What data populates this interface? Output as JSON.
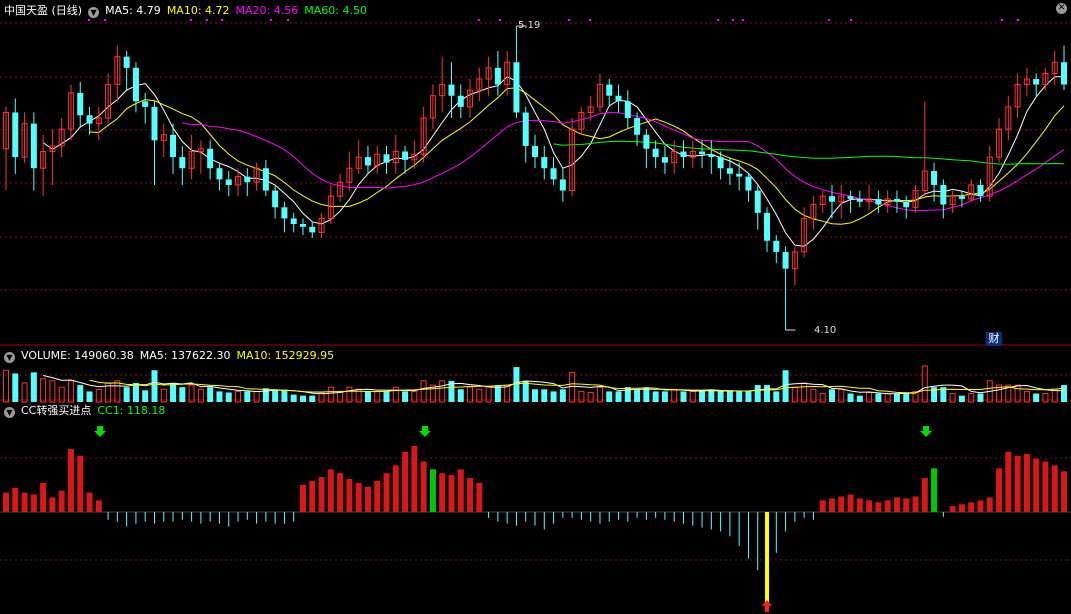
{
  "main_panel": {
    "stock_name": "中国天盈 (日线)",
    "indicators": [
      {
        "label": "MA5: 4.79",
        "color": "#ffffff"
      },
      {
        "label": "MA10: 4.72",
        "color": "#ffff00"
      },
      {
        "label": "MA20: 4.56",
        "color": "#ff00ff"
      },
      {
        "label": "MA60: 4.50",
        "color": "#00ff00"
      }
    ],
    "high_label": "5.19",
    "low_label": "4.10",
    "finance_badge": "财"
  },
  "volume_panel": {
    "indicators": [
      {
        "label": "VOLUME: 149060.38",
        "color": "#ffffff"
      },
      {
        "label": "MA5: 137622.30",
        "color": "#ffffff"
      },
      {
        "label": "MA10: 152929.95",
        "color": "#ffff00"
      }
    ]
  },
  "cc_panel": {
    "indicators": [
      {
        "label": "CC转强买进点",
        "color": "#ffffff"
      },
      {
        "label": "CC1: 118.18",
        "color": "#00ff00"
      }
    ]
  },
  "colors": {
    "up": "#ff3232",
    "down": "#54ffff",
    "grid": "#7a1a1a",
    "ma5": "#ffffff",
    "ma10": "#ffff00",
    "ma20": "#ff00ff",
    "ma60": "#00ff00",
    "cc_up": "#d81818",
    "cc_down": "#54ffff",
    "cc_signal": "#00c800",
    "cc_extreme": "#ffff00"
  },
  "chart_data": {
    "type": "candlestick",
    "price_range": [
      4.1,
      5.19
    ],
    "candles": [
      [
        4.75,
        4.88,
        4.6,
        4.9
      ],
      [
        4.88,
        4.72,
        4.66,
        4.93
      ],
      [
        4.72,
        4.84,
        4.7,
        4.88
      ],
      [
        4.84,
        4.68,
        4.6,
        4.88
      ],
      [
        4.68,
        4.74,
        4.58,
        4.8
      ],
      [
        4.74,
        4.76,
        4.62,
        4.82
      ],
      [
        4.76,
        4.82,
        4.72,
        4.86
      ],
      [
        4.82,
        4.95,
        4.78,
        4.98
      ],
      [
        4.95,
        4.87,
        4.83,
        4.99
      ],
      [
        4.87,
        4.84,
        4.8,
        4.9
      ],
      [
        4.84,
        4.86,
        4.78,
        4.9
      ],
      [
        4.86,
        4.98,
        4.84,
        5.02
      ],
      [
        4.98,
        5.08,
        4.92,
        5.12
      ],
      [
        5.08,
        5.04,
        4.96,
        5.1
      ],
      [
        5.04,
        4.92,
        4.88,
        5.06
      ],
      [
        4.92,
        4.9,
        4.84,
        4.95
      ],
      [
        4.9,
        4.78,
        4.62,
        4.92
      ],
      [
        4.78,
        4.8,
        4.72,
        4.84
      ],
      [
        4.8,
        4.72,
        4.66,
        4.84
      ],
      [
        4.72,
        4.68,
        4.62,
        4.76
      ],
      [
        4.68,
        4.74,
        4.64,
        4.8
      ],
      [
        4.74,
        4.75,
        4.66,
        4.78
      ],
      [
        4.75,
        4.68,
        4.64,
        4.78
      ],
      [
        4.68,
        4.64,
        4.6,
        4.7
      ],
      [
        4.64,
        4.62,
        4.58,
        4.67
      ],
      [
        4.62,
        4.65,
        4.58,
        4.68
      ],
      [
        4.65,
        4.63,
        4.58,
        4.68
      ],
      [
        4.63,
        4.68,
        4.6,
        4.7
      ],
      [
        4.68,
        4.6,
        4.58,
        4.71
      ],
      [
        4.6,
        4.54,
        4.5,
        4.62
      ],
      [
        4.54,
        4.5,
        4.45,
        4.56
      ],
      [
        4.5,
        4.48,
        4.45,
        4.52
      ],
      [
        4.48,
        4.47,
        4.44,
        4.5
      ],
      [
        4.47,
        4.45,
        4.43,
        4.49
      ],
      [
        4.45,
        4.5,
        4.43,
        4.52
      ],
      [
        4.5,
        4.58,
        4.48,
        4.62
      ],
      [
        4.58,
        4.63,
        4.56,
        4.66
      ],
      [
        4.63,
        4.68,
        4.6,
        4.74
      ],
      [
        4.68,
        4.72,
        4.66,
        4.78
      ],
      [
        4.72,
        4.69,
        4.66,
        4.76
      ],
      [
        4.69,
        4.73,
        4.66,
        4.76
      ],
      [
        4.73,
        4.7,
        4.66,
        4.76
      ],
      [
        4.7,
        4.74,
        4.66,
        4.8
      ],
      [
        4.74,
        4.71,
        4.66,
        4.76
      ],
      [
        4.71,
        4.73,
        4.68,
        4.78
      ],
      [
        4.73,
        4.86,
        4.7,
        4.9
      ],
      [
        4.86,
        4.94,
        4.82,
        4.98
      ],
      [
        4.94,
        4.98,
        4.88,
        5.08
      ],
      [
        4.98,
        4.94,
        4.86,
        5.06
      ],
      [
        4.94,
        4.9,
        4.86,
        4.98
      ],
      [
        4.9,
        4.96,
        4.86,
        5.0
      ],
      [
        4.96,
        5.0,
        4.92,
        5.04
      ],
      [
        5.0,
        5.04,
        4.94,
        5.08
      ],
      [
        5.04,
        4.98,
        4.94,
        5.1
      ],
      [
        4.98,
        5.06,
        4.94,
        5.1
      ],
      [
        5.06,
        4.88,
        4.86,
        5.19
      ],
      [
        4.88,
        4.76,
        4.7,
        4.9
      ],
      [
        4.76,
        4.72,
        4.68,
        4.8
      ],
      [
        4.72,
        4.68,
        4.64,
        4.76
      ],
      [
        4.68,
        4.64,
        4.62,
        4.72
      ],
      [
        4.64,
        4.6,
        4.56,
        4.68
      ],
      [
        4.6,
        4.82,
        4.58,
        4.86
      ],
      [
        4.82,
        4.88,
        4.8,
        4.9
      ],
      [
        4.88,
        4.9,
        4.85,
        4.94
      ],
      [
        4.9,
        4.98,
        4.88,
        5.02
      ],
      [
        4.98,
        4.94,
        4.9,
        5.0
      ],
      [
        4.94,
        4.92,
        4.88,
        4.98
      ],
      [
        4.92,
        4.86,
        4.82,
        4.96
      ],
      [
        4.86,
        4.8,
        4.76,
        4.88
      ],
      [
        4.8,
        4.75,
        4.68,
        4.82
      ],
      [
        4.75,
        4.72,
        4.68,
        4.78
      ],
      [
        4.72,
        4.7,
        4.66,
        4.76
      ],
      [
        4.7,
        4.74,
        4.66,
        4.78
      ],
      [
        4.74,
        4.72,
        4.68,
        4.78
      ],
      [
        4.72,
        4.74,
        4.68,
        4.78
      ],
      [
        4.74,
        4.73,
        4.68,
        4.78
      ],
      [
        4.73,
        4.72,
        4.66,
        4.78
      ],
      [
        4.72,
        4.68,
        4.64,
        4.74
      ],
      [
        4.68,
        4.66,
        4.62,
        4.72
      ],
      [
        4.66,
        4.65,
        4.6,
        4.7
      ],
      [
        4.65,
        4.6,
        4.56,
        4.66
      ],
      [
        4.6,
        4.52,
        4.46,
        4.62
      ],
      [
        4.52,
        4.42,
        4.38,
        4.54
      ],
      [
        4.42,
        4.38,
        4.34,
        4.44
      ],
      [
        4.38,
        4.32,
        4.1,
        4.4
      ],
      [
        4.32,
        4.38,
        4.26,
        4.4
      ],
      [
        4.38,
        4.5,
        4.36,
        4.54
      ],
      [
        4.5,
        4.55,
        4.46,
        4.58
      ],
      [
        4.55,
        4.58,
        4.52,
        4.6
      ],
      [
        4.58,
        4.56,
        4.5,
        4.62
      ],
      [
        4.56,
        4.58,
        4.5,
        4.62
      ],
      [
        4.58,
        4.57,
        4.52,
        4.6
      ],
      [
        4.57,
        4.56,
        4.54,
        4.6
      ],
      [
        4.56,
        4.57,
        4.53,
        4.62
      ],
      [
        4.57,
        4.55,
        4.52,
        4.6
      ],
      [
        4.55,
        4.57,
        4.52,
        4.6
      ],
      [
        4.57,
        4.56,
        4.52,
        4.6
      ],
      [
        4.56,
        4.54,
        4.5,
        4.58
      ],
      [
        4.54,
        4.6,
        4.52,
        4.62
      ],
      [
        4.6,
        4.67,
        4.58,
        4.92
      ],
      [
        4.67,
        4.62,
        4.56,
        4.7
      ],
      [
        4.62,
        4.55,
        4.5,
        4.64
      ],
      [
        4.55,
        4.58,
        4.52,
        4.6
      ],
      [
        4.58,
        4.57,
        4.54,
        4.6
      ],
      [
        4.57,
        4.62,
        4.56,
        4.64
      ],
      [
        4.62,
        4.58,
        4.56,
        4.64
      ],
      [
        4.58,
        4.72,
        4.56,
        4.76
      ],
      [
        4.72,
        4.82,
        4.7,
        4.86
      ],
      [
        4.82,
        4.9,
        4.78,
        4.94
      ],
      [
        4.9,
        4.98,
        4.86,
        5.02
      ],
      [
        4.98,
        5.0,
        4.94,
        5.04
      ],
      [
        5.0,
        4.98,
        4.94,
        5.02
      ],
      [
        4.98,
        5.02,
        4.96,
        5.04
      ],
      [
        5.02,
        5.06,
        4.98,
        5.1
      ],
      [
        5.06,
        4.98,
        4.96,
        5.12
      ]
    ],
    "cc_values": [
      20,
      25,
      20,
      18,
      30,
      15,
      22,
      65,
      58,
      20,
      12,
      -8,
      -10,
      -15,
      -12,
      -10,
      -12,
      -10,
      -10,
      -8,
      -10,
      -12,
      -10,
      -12,
      -15,
      -10,
      -8,
      -12,
      -10,
      -12,
      -12,
      -10,
      28,
      32,
      36,
      44,
      40,
      34,
      30,
      26,
      32,
      40,
      48,
      62,
      68,
      52,
      44,
      40,
      38,
      44,
      35,
      30,
      -6,
      -10,
      -12,
      -14,
      -10,
      -14,
      -18,
      -12,
      -6,
      -6,
      -8,
      -10,
      -12,
      -10,
      -8,
      -10,
      -6,
      -8,
      -6,
      -8,
      -10,
      -12,
      -14,
      -16,
      -18,
      -20,
      -25,
      -35,
      -48,
      -60,
      -96,
      -42,
      -20,
      -10,
      -6,
      -8,
      12,
      14,
      16,
      18,
      14,
      12,
      10,
      12,
      15,
      14,
      16,
      35,
      45,
      -5,
      6,
      8,
      10,
      12,
      15,
      45,
      62,
      58,
      60,
      55,
      52,
      48,
      42
    ]
  }
}
